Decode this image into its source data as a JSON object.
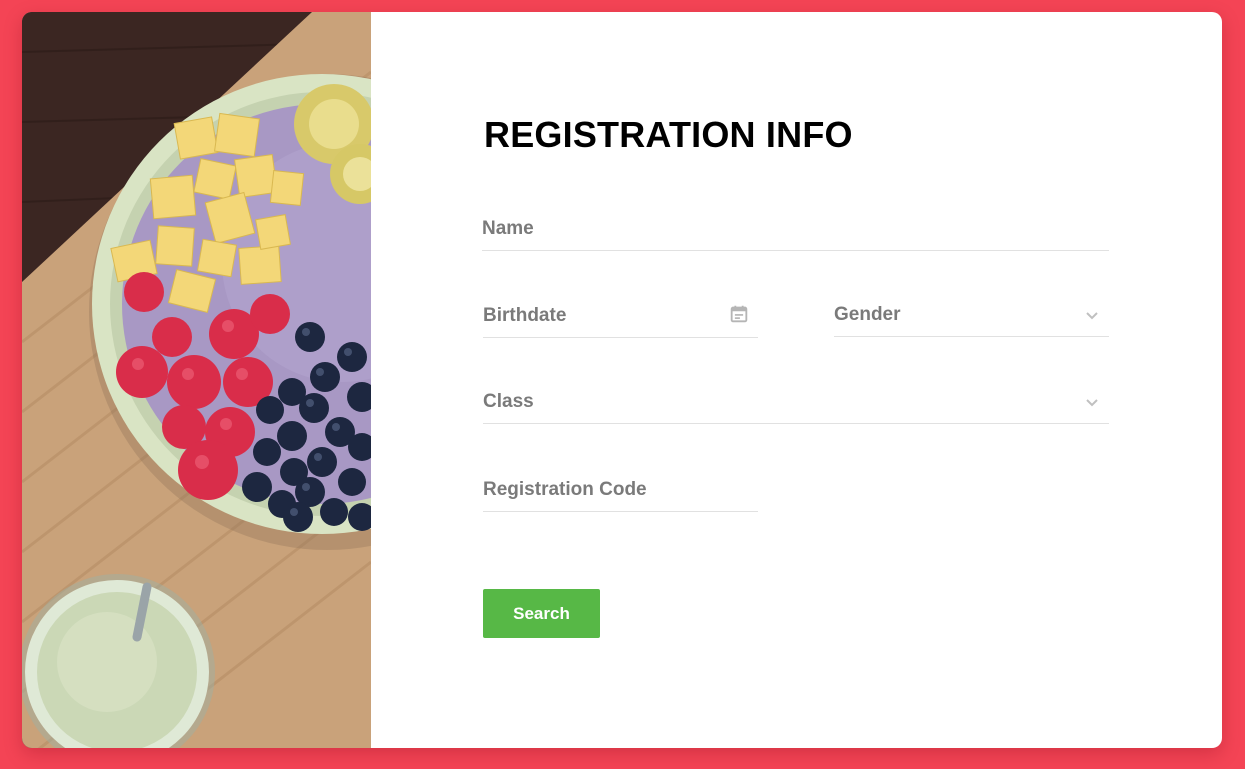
{
  "form": {
    "title": "REGISTRATION INFO",
    "fields": {
      "name": {
        "label": "Name"
      },
      "birthdate": {
        "label": "Birthdate",
        "icon": "calendar-icon"
      },
      "gender": {
        "label": "Gender",
        "icon": "chevron-down-icon"
      },
      "class": {
        "label": "Class",
        "icon": "chevron-down-icon"
      },
      "registration_code": {
        "label": "Registration Code"
      }
    },
    "submit_label": "Search"
  },
  "colors": {
    "background": "#f44455",
    "card": "#ffffff",
    "accent_button": "#57b846",
    "label": "#7a7a7a",
    "underline": "#e1e1e1"
  }
}
